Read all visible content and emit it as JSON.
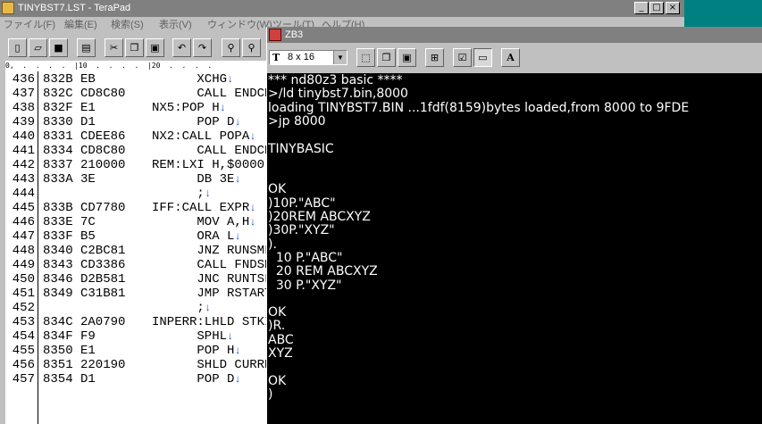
{
  "teraPad": {
    "title": "TINYBST7.LST - TeraPad",
    "menu": [
      "ファイル(F)",
      "編集(E)",
      "検索(S)",
      "表示(V)",
      "ウィンドウ(W)",
      "ツール(T)",
      "ヘルプ(H)"
    ],
    "window_buttons": {
      "minimize": "_",
      "maximize": "□",
      "close": "×"
    },
    "toolbar_icons": [
      "new-file-icon",
      "open-folder-icon",
      "save-icon",
      "print-icon",
      "cut-icon",
      "copy-icon",
      "paste-icon",
      "undo-icon",
      "redo-icon",
      "find-icon",
      "find-next-icon"
    ],
    "ruler": "0,  .  .  .  .  |10  .  .  .  .  |20  .  .  .  .",
    "lines": [
      {
        "n": "436",
        "addr": "832B",
        "hex": "EB",
        "src": "      XCHG"
      },
      {
        "n": "437",
        "addr": "832C",
        "hex": "CD8C80",
        "src": "      CALL ENDCK"
      },
      {
        "n": "438",
        "addr": "832F",
        "hex": "E1",
        "src": "NX5:POP H"
      },
      {
        "n": "439",
        "addr": "8330",
        "hex": "D1",
        "src": "      POP D"
      },
      {
        "n": "440",
        "addr": "8331",
        "hex": "CDEE86",
        "src": "NX2:CALL POPA"
      },
      {
        "n": "441",
        "addr": "8334",
        "hex": "CD8C80",
        "src": "      CALL ENDCK"
      },
      {
        "n": "442",
        "addr": "8337",
        "hex": "210000",
        "src": "REM:LXI H,$0000"
      },
      {
        "n": "443",
        "addr": "833A",
        "hex": "3E",
        "src": "      DB 3E"
      },
      {
        "n": "444",
        "addr": "",
        "hex": "",
        "src": "      ;"
      },
      {
        "n": "445",
        "addr": "833B",
        "hex": "CD7780",
        "src": "IFF:CALL EXPR"
      },
      {
        "n": "446",
        "addr": "833E",
        "hex": "7C",
        "src": "      MOV A,H"
      },
      {
        "n": "447",
        "addr": "833F",
        "hex": "B5",
        "src": "      ORA L"
      },
      {
        "n": "448",
        "addr": "8340",
        "hex": "C2BC81",
        "src": "      JNZ RUNSML"
      },
      {
        "n": "449",
        "addr": "8343",
        "hex": "CD3386",
        "src": "      CALL FNDSKP"
      },
      {
        "n": "450",
        "addr": "8346",
        "hex": "D2B581",
        "src": "      JNC RUNTSL"
      },
      {
        "n": "451",
        "addr": "8349",
        "hex": "C31B81",
        "src": "      JMP RSTART"
      },
      {
        "n": "452",
        "addr": "",
        "hex": "",
        "src": "      ;"
      },
      {
        "n": "453",
        "addr": "834C",
        "hex": "2A0790",
        "src": "INPERR:LHLD STKI"
      },
      {
        "n": "454",
        "addr": "834F",
        "hex": "F9",
        "src": "      SPHL"
      },
      {
        "n": "455",
        "addr": "8350",
        "hex": "E1",
        "src": "      POP H"
      },
      {
        "n": "456",
        "addr": "8351",
        "hex": "220190",
        "src": "      SHLD CURRNT"
      },
      {
        "n": "457",
        "addr": "8354",
        "hex": "D1",
        "src": "      POP D"
      }
    ],
    "return_mark": "↓"
  },
  "zb3": {
    "title": "ZB3",
    "font_icon": "T",
    "font_size": "8 x 16",
    "dropdown_arrow": "▼",
    "toolbar_icons": [
      "select-icon",
      "copy-icon",
      "paste-icon",
      "fit-icon",
      "properties-icon",
      "window-icon",
      "font-icon"
    ],
    "font_button": "A",
    "terminal_lines": [
      "*** nd80z3 basic ****",
      ">/ld tinybst7.bin,8000",
      "loading TINYBST7.BIN ...1fdf(8159)bytes loaded,from 8000 to 9FDE",
      ">jp 8000",
      "",
      "TINYBASIC",
      "",
      "",
      "OK",
      ")10P.\"ABC\"",
      ")20REM ABCXYZ",
      ")30P.\"XYZ\"",
      ").",
      "  10 P.\"ABC\"",
      "  20 REM ABCXYZ",
      "  30 P.\"XYZ\"",
      "",
      "OK",
      ")R.",
      "ABC",
      "XYZ",
      "",
      "OK",
      ")"
    ]
  }
}
